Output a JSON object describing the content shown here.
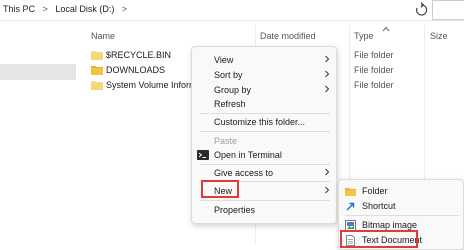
{
  "breadcrumb": {
    "this_pc": "This PC",
    "sep1": ">",
    "local_disk": "Local Disk (D:)",
    "sep2": ">"
  },
  "columns": {
    "name": "Name",
    "date_modified": "Date modified",
    "type": "Type",
    "size": "Size"
  },
  "files": [
    {
      "name": "$RECYCLE.BIN",
      "type": "File folder",
      "icon": "system-folder-icon"
    },
    {
      "name": "DOWNLOADS",
      "type": "File folder",
      "icon": "folder-icon"
    },
    {
      "name": "System Volume Informati",
      "type": "File folder",
      "icon": "system-folder-icon"
    }
  ],
  "context_menu": {
    "view": "View",
    "sort_by": "Sort by",
    "group_by": "Group by",
    "refresh": "Refresh",
    "customize": "Customize this folder...",
    "paste": "Paste",
    "open_terminal": "Open in Terminal",
    "give_access": "Give access to",
    "new": "New",
    "properties": "Properties"
  },
  "new_submenu": {
    "folder": "Folder",
    "shortcut": "Shortcut",
    "bitmap": "Bitmap image",
    "text_document": "Text Document"
  },
  "colors": {
    "highlight_border": "#e03c3c",
    "folder": "#f3c443",
    "selection": "#e5e5e5"
  }
}
